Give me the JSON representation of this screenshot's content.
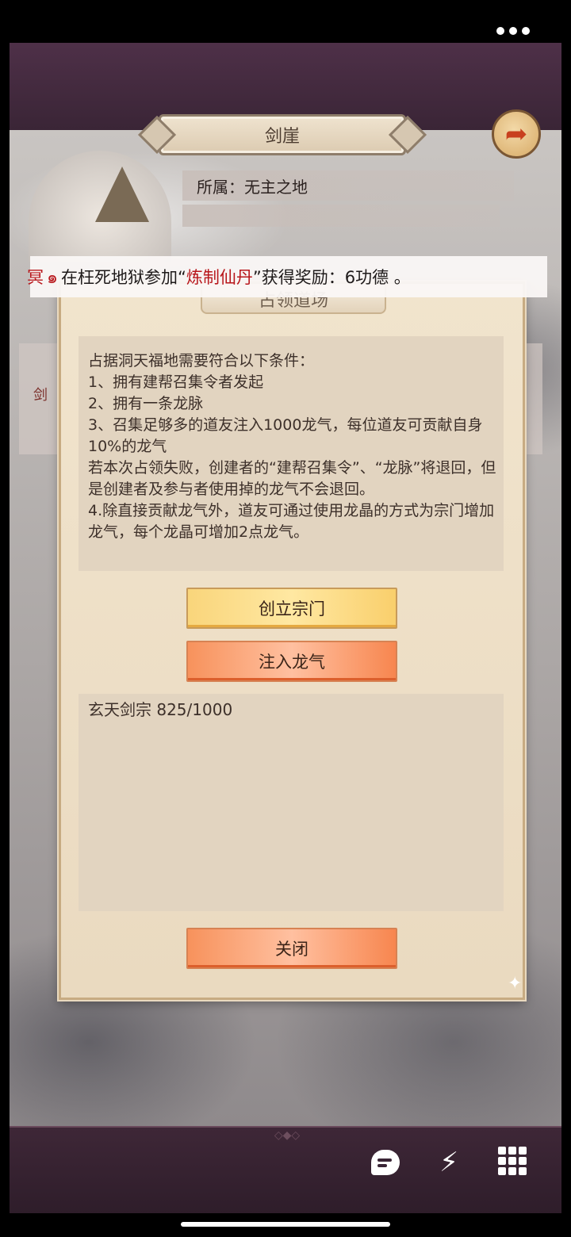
{
  "status_bar": {
    "menu_icon": "more-dots-icon"
  },
  "header": {
    "title": "剑崖",
    "back_icon": "back-arrow-icon"
  },
  "info": {
    "affiliation": "所属：无主之地",
    "side_label": "剑"
  },
  "banner": {
    "prefix": "冥",
    "icon": "cloud-swirl-icon",
    "place": "在枉死地狱",
    "verb": "参加“",
    "event": "炼制仙丹",
    "reward": "”获得奖励：6功德 。"
  },
  "modal": {
    "title": "占领道场",
    "rules": [
      "占据洞天福地需要符合以下条件：",
      "1、拥有建帮召集令者发起",
      "2、拥有一条龙脉",
      "3、召集足够多的道友注入1000龙气，每位道友可贡献自身10%的龙气",
      "若本次占领失败，创建者的“建帮召集令”、“龙脉”将退回，但是创建者及参与者使用掉的龙气不会退回。",
      "4.除直接贡献龙气外，道友可通过使用龙晶的方式为宗门增加龙气，每个龙晶可增加2点龙气。"
    ],
    "create_sect_button": "创立宗门",
    "inject_button": "注入龙气",
    "list": [
      {
        "sect": "玄天剑宗 825/1000"
      }
    ],
    "close_button": "关闭"
  },
  "toolbar": {
    "chat_icon": "chat-icon",
    "effects_icon": "magic-wand-icon",
    "menu_icon": "grid-menu-icon"
  },
  "colors": {
    "accent_red": "#b8161b",
    "gold_button": "#f9d57b",
    "orange_button": "#f7925c",
    "modal_bg": "#f1e4cd"
  }
}
